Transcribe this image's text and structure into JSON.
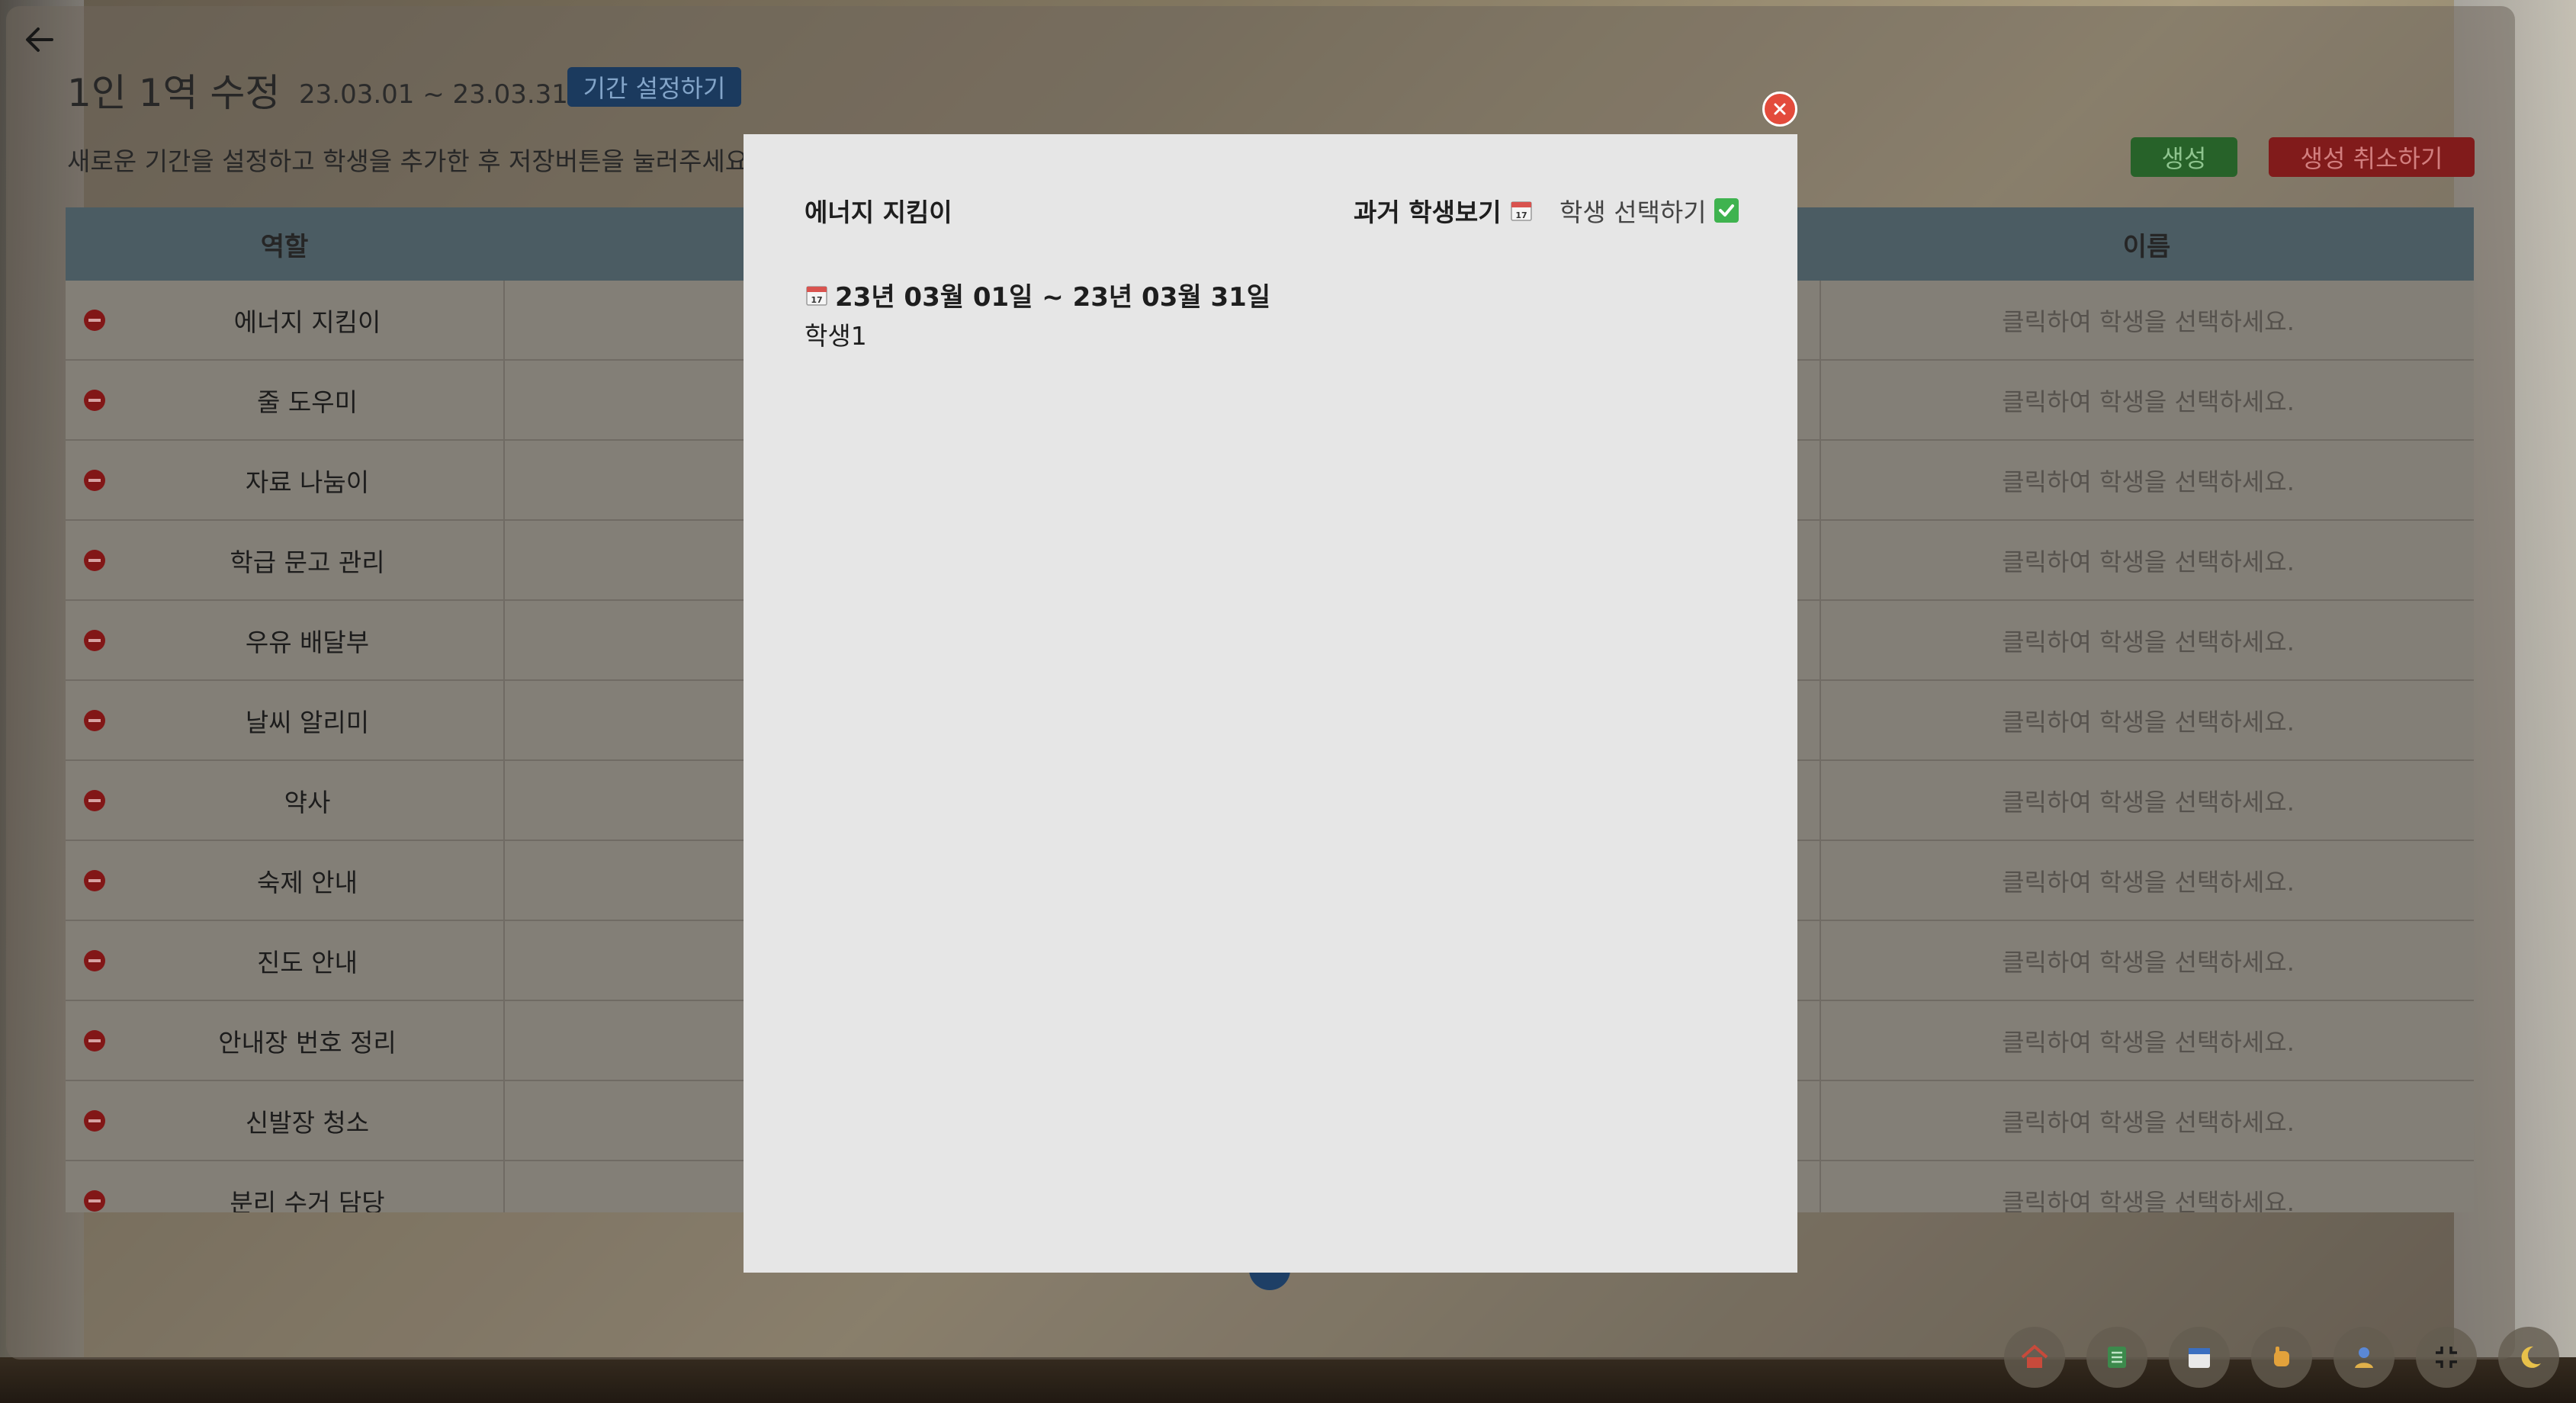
{
  "page": {
    "title": "1인 1역 수정",
    "period": "23.03.01 ~ 23.03.31",
    "period_button": "기간 설정하기",
    "instruction": "새로운 기간을 설정하고 학생을 추가한 후 저장버튼을 눌러주세요.",
    "create_button": "생성",
    "cancel_create_button": "생성 취소하기"
  },
  "table": {
    "headers": {
      "role": "역할",
      "name": "이름"
    },
    "rows": [
      {
        "role": "에너지 지킴이",
        "name": "클릭하여 학생을 선택하세요."
      },
      {
        "role": "줄 도우미",
        "name": "클릭하여 학생을 선택하세요."
      },
      {
        "role": "자료 나눔이",
        "name": "클릭하여 학생을 선택하세요."
      },
      {
        "role": "학급 문고 관리",
        "name": "클릭하여 학생을 선택하세요."
      },
      {
        "role": "우유 배달부",
        "name": "클릭하여 학생을 선택하세요."
      },
      {
        "role": "날씨 알리미",
        "name": "클릭하여 학생을 선택하세요."
      },
      {
        "role": "약사",
        "name": "클릭하여 학생을 선택하세요."
      },
      {
        "role": "숙제 안내",
        "name": "클릭하여 학생을 선택하세요."
      },
      {
        "role": "진도 안내",
        "name": "클릭하여 학생을 선택하세요."
      },
      {
        "role": "안내장 번호 정리",
        "name": "클릭하여 학생을 선택하세요."
      },
      {
        "role": "신발장 청소",
        "name": "클릭하여 학생을 선택하세요."
      },
      {
        "role": "분리 수거 담당",
        "name": "클릭하여 학생을 선택하세요."
      }
    ]
  },
  "modal": {
    "title": "에너지 지킴이",
    "past_students_label": "과거 학생보기",
    "select_student_label": "학생 선택하기",
    "date_range": "23년 03월 01일 ~ 23년 03월 31일",
    "students": [
      "학생1"
    ]
  },
  "icons": {
    "back": "arrow-left-icon",
    "close": "close-icon",
    "calendar": "calendar-icon",
    "check": "check-icon",
    "remove": "remove-icon",
    "dock": [
      "home-icon",
      "list-icon",
      "calendar-icon",
      "hand-icon",
      "user-icon",
      "collapse-icon",
      "moon-icon"
    ]
  },
  "colors": {
    "period_button": "#1e3f66",
    "create_button": "#2b6b2d",
    "cancel_button": "#8c1e1e",
    "close_button": "#e34b3c",
    "modal_bg": "#e6e6e6"
  }
}
